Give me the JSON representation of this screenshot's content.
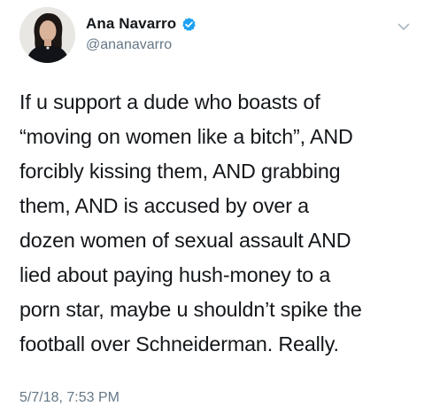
{
  "author": {
    "display_name": "Ana Navarro",
    "handle": "@ananavarro",
    "verified": true,
    "verified_icon": "verified-badge-icon",
    "avatar_icon": "avatar"
  },
  "menu_icon": "chevron-down-icon",
  "tweet": {
    "lines": [
      "If u support a dude who boasts of",
      "“moving on women like a bitch”, AND",
      "forcibly kissing them, AND grabbing",
      "them, AND is accused by over a",
      "dozen women of sexual assault AND",
      "lied about paying hush-money to a",
      "porn star, maybe u shouldn’t spike the",
      "football over Schneiderman. Really."
    ],
    "timestamp": "5/7/18, 7:53 PM"
  },
  "colors": {
    "text": "#14171a",
    "secondary": "#657786",
    "verified_blue": "#1da1f2"
  }
}
